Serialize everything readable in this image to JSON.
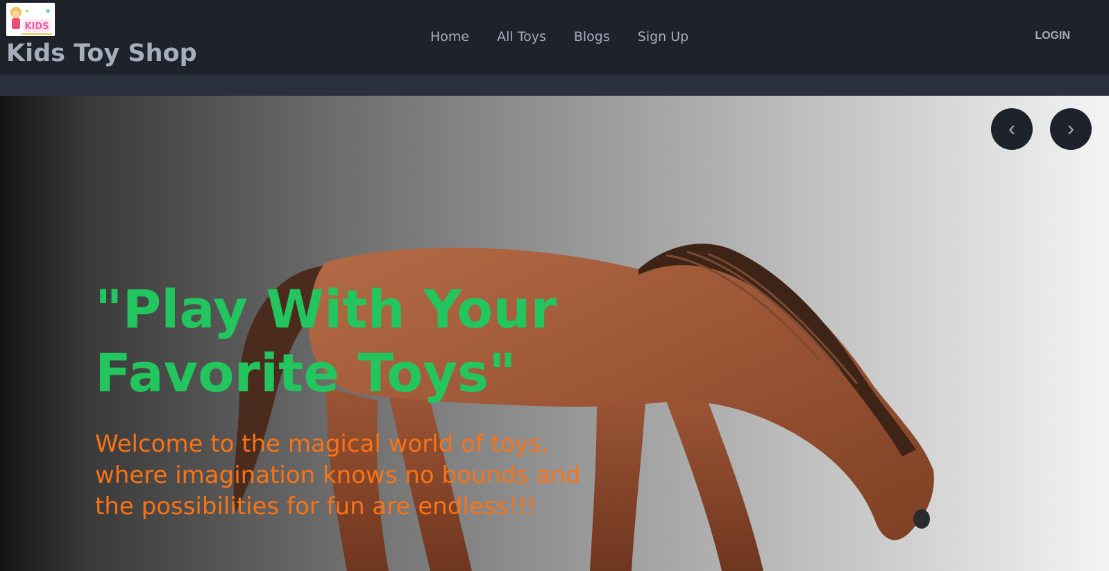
{
  "brand": {
    "title": "Kids Toy Shop",
    "logo_label": "KIDS"
  },
  "nav": {
    "items": [
      {
        "label": "Home"
      },
      {
        "label": "All Toys"
      },
      {
        "label": "Blogs"
      },
      {
        "label": "Sign Up"
      }
    ],
    "login_label": "LOGIN"
  },
  "hero": {
    "heading": "\"Play With Your Favorite Toys\"",
    "subtitle": "Welcome to the magical world of toys, where imagination knows no bounds and the possibilities for fun are endless!!!",
    "prev_icon": "‹",
    "next_icon": "›"
  },
  "colors": {
    "nav_bg": "#1e222b",
    "subbar_bg": "#2a303c",
    "nav_text": "#a6adbb",
    "heading": "#22c55e",
    "subtitle": "#f97316"
  }
}
